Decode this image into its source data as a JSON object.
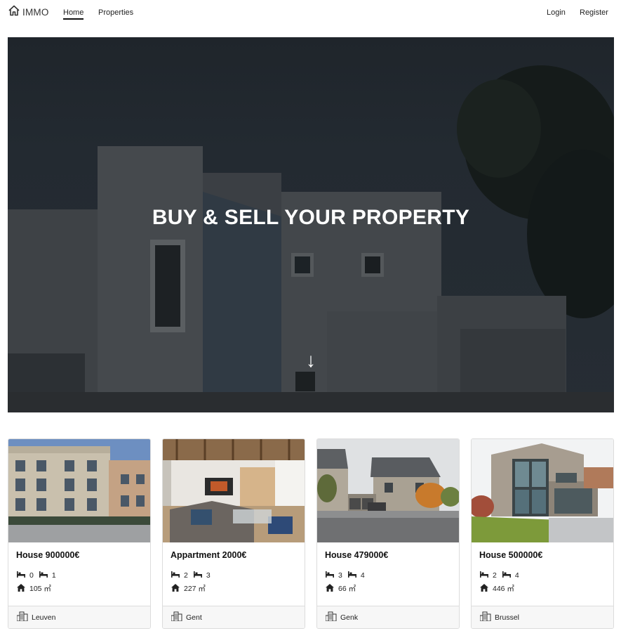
{
  "nav": {
    "brand": "IMMO",
    "links": [
      "Home",
      "Properties"
    ],
    "active": "Home",
    "right": [
      "Login",
      "Register"
    ]
  },
  "hero": {
    "title": "BUY & SELL YOUR PROPERTY",
    "arrow": "↓"
  },
  "listings": [
    {
      "title": "House 900000€",
      "beds": "0",
      "baths": "1",
      "area": "105 ㎡",
      "city": "Leuven"
    },
    {
      "title": "Appartment 2000€",
      "beds": "2",
      "baths": "3",
      "area": "227 ㎡",
      "city": "Gent"
    },
    {
      "title": "House 479000€",
      "beds": "3",
      "baths": "4",
      "area": "66 ㎡",
      "city": "Genk"
    },
    {
      "title": "House 500000€",
      "beds": "2",
      "baths": "4",
      "area": "446 ㎡",
      "city": "Brussel"
    }
  ],
  "icons": {
    "brand": "house-outline-icon",
    "beds": "bed-icon",
    "baths": "bath-icon",
    "area": "home-icon",
    "city": "city-icon"
  }
}
